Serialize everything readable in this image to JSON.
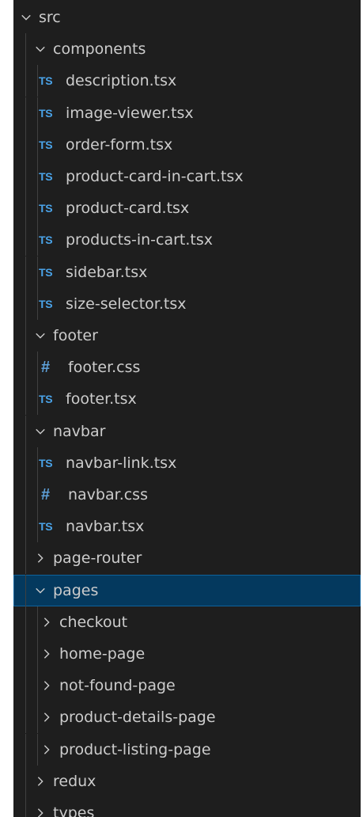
{
  "explorer": {
    "tree": [
      {
        "label": "src",
        "type": "folder",
        "expanded": true,
        "depth": 0,
        "icon": "chevron-down-icon"
      },
      {
        "label": "components",
        "type": "folder",
        "expanded": true,
        "depth": 1,
        "icon": "chevron-down-icon"
      },
      {
        "label": "description.tsx",
        "type": "file",
        "depth": 2,
        "icon": "typescript-file-icon",
        "icon_text": "TS"
      },
      {
        "label": "image-viewer.tsx",
        "type": "file",
        "depth": 2,
        "icon": "typescript-file-icon",
        "icon_text": "TS"
      },
      {
        "label": "order-form.tsx",
        "type": "file",
        "depth": 2,
        "icon": "typescript-file-icon",
        "icon_text": "TS"
      },
      {
        "label": "product-card-in-cart.tsx",
        "type": "file",
        "depth": 2,
        "icon": "typescript-file-icon",
        "icon_text": "TS"
      },
      {
        "label": "product-card.tsx",
        "type": "file",
        "depth": 2,
        "icon": "typescript-file-icon",
        "icon_text": "TS"
      },
      {
        "label": "products-in-cart.tsx",
        "type": "file",
        "depth": 2,
        "icon": "typescript-file-icon",
        "icon_text": "TS"
      },
      {
        "label": "sidebar.tsx",
        "type": "file",
        "depth": 2,
        "icon": "typescript-file-icon",
        "icon_text": "TS"
      },
      {
        "label": "size-selector.tsx",
        "type": "file",
        "depth": 2,
        "icon": "typescript-file-icon",
        "icon_text": "TS"
      },
      {
        "label": "footer",
        "type": "folder",
        "expanded": true,
        "depth": 1,
        "icon": "chevron-down-icon"
      },
      {
        "label": "footer.css",
        "type": "file",
        "depth": 2,
        "icon": "css-file-icon",
        "icon_text": "#"
      },
      {
        "label": "footer.tsx",
        "type": "file",
        "depth": 2,
        "icon": "typescript-file-icon",
        "icon_text": "TS"
      },
      {
        "label": "navbar",
        "type": "folder",
        "expanded": true,
        "depth": 1,
        "icon": "chevron-down-icon"
      },
      {
        "label": "navbar-link.tsx",
        "type": "file",
        "depth": 2,
        "icon": "typescript-file-icon",
        "icon_text": "TS"
      },
      {
        "label": "navbar.css",
        "type": "file",
        "depth": 2,
        "icon": "css-file-icon",
        "icon_text": "#"
      },
      {
        "label": "navbar.tsx",
        "type": "file",
        "depth": 2,
        "icon": "typescript-file-icon",
        "icon_text": "TS"
      },
      {
        "label": "page-router",
        "type": "folder",
        "expanded": false,
        "depth": 1,
        "icon": "chevron-right-icon"
      },
      {
        "label": "pages",
        "type": "folder",
        "expanded": true,
        "depth": 1,
        "icon": "chevron-down-icon",
        "selected": true
      },
      {
        "label": "checkout",
        "type": "folder",
        "expanded": false,
        "depth": 2,
        "icon": "chevron-right-icon"
      },
      {
        "label": "home-page",
        "type": "folder",
        "expanded": false,
        "depth": 2,
        "icon": "chevron-right-icon"
      },
      {
        "label": "not-found-page",
        "type": "folder",
        "expanded": false,
        "depth": 2,
        "icon": "chevron-right-icon"
      },
      {
        "label": "product-details-page",
        "type": "folder",
        "expanded": false,
        "depth": 2,
        "icon": "chevron-right-icon"
      },
      {
        "label": "product-listing-page",
        "type": "folder",
        "expanded": false,
        "depth": 2,
        "icon": "chevron-right-icon"
      },
      {
        "label": "redux",
        "type": "folder",
        "expanded": false,
        "depth": 1,
        "icon": "chevron-right-icon"
      },
      {
        "label": "types",
        "type": "folder",
        "expanded": false,
        "depth": 1,
        "icon": "chevron-right-icon"
      }
    ]
  },
  "colors": {
    "background": "#1e1e1e",
    "text": "#cccccc",
    "selection": "#04395e",
    "selection_border": "#0e639c",
    "typescript_icon": "#4aa3e8",
    "css_icon": "#5ea1da"
  }
}
